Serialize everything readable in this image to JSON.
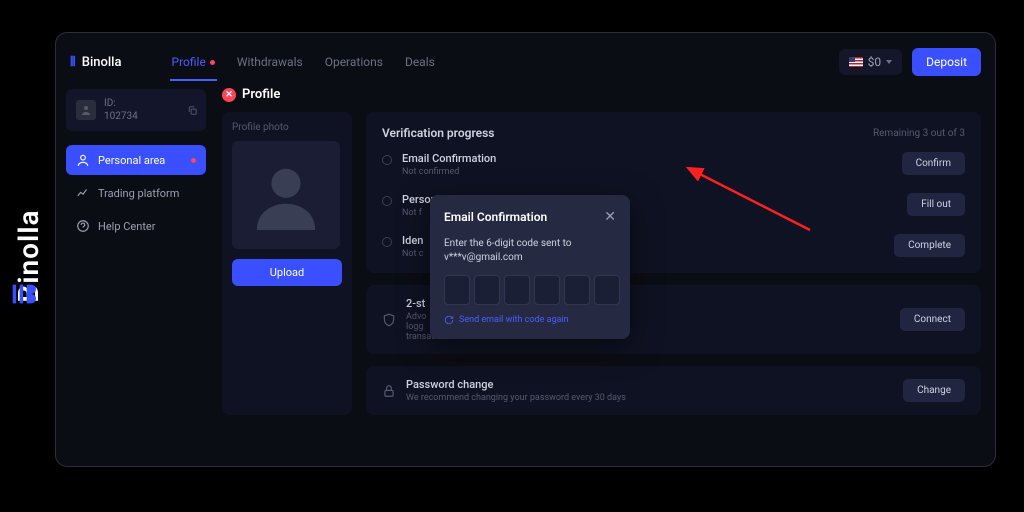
{
  "brand": "Binolla",
  "tabs": {
    "profile": "Profile",
    "withdrawals": "Withdrawals",
    "operations": "Operations",
    "deals": "Deals"
  },
  "balance": {
    "amount": "$0"
  },
  "deposit_btn": "Deposit",
  "user": {
    "id_label": "ID:",
    "id": "102734"
  },
  "nav": {
    "personal": "Personal area",
    "trading": "Trading platform",
    "help": "Help Center"
  },
  "page_heading": "Profile",
  "photo": {
    "label": "Profile photo",
    "upload": "Upload"
  },
  "verification": {
    "title": "Verification progress",
    "remaining": "Remaining 3 out of 3",
    "email": {
      "title": "Email Confirmation",
      "sub": "Not confirmed",
      "btn": "Confirm"
    },
    "personal": {
      "title": "Personal data",
      "sub": "Not f",
      "btn": "Fill out"
    },
    "identity": {
      "title": "Iden",
      "sub": "Not c",
      "btn": "Complete"
    }
  },
  "twostep": {
    "title": "2-st",
    "sub": "Advo\nlogg\ntransactions",
    "btn": "Connect"
  },
  "password": {
    "title": "Password change",
    "sub": "We recommend changing your password every 30 days",
    "btn": "Change"
  },
  "modal": {
    "title": "Email Confirmation",
    "msg_l1": "Enter the 6-digit code sent to",
    "msg_l2": "v***v@gmail.com",
    "resend": "Send email with code again"
  }
}
